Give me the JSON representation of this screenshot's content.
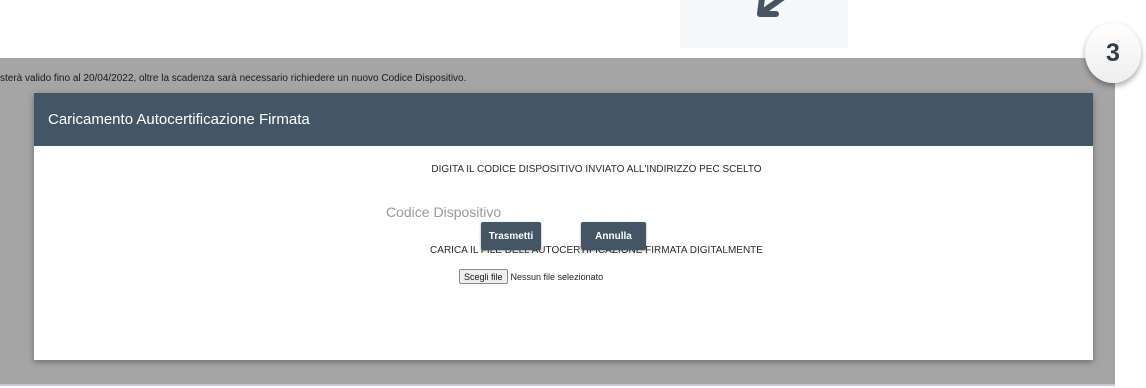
{
  "step_badge": "3",
  "icons": {
    "arrow": "arrow-down-left-icon"
  },
  "notice_text": "sterà valido fino al 20/04/2022, oltre la scadenza sarà necessario richiedere un nuovo Codice Dispositivo.",
  "modal": {
    "title": "Caricamento Autocertificazione Firmata",
    "instruction_code": "DIGITA IL CODICE DISPOSITIVO INVIATO ALL'INDIRIZZO PEC SCELTO",
    "code_field": {
      "placeholder": "Codice Dispositivo",
      "value": ""
    },
    "instruction_file": "CARICA IL FILE DELL'AUTOCERTIFICAZIONE FIRMATA DIGITALMENTE",
    "file_input": {
      "button_label": "Scegli file",
      "status_text": "Nessun file selezionato"
    },
    "buttons": {
      "submit": "Trasmetti",
      "cancel": "Annulla"
    }
  },
  "colors": {
    "header_bg": "#435665",
    "button_bg": "#435665",
    "backdrop": "#a5a5a5"
  }
}
